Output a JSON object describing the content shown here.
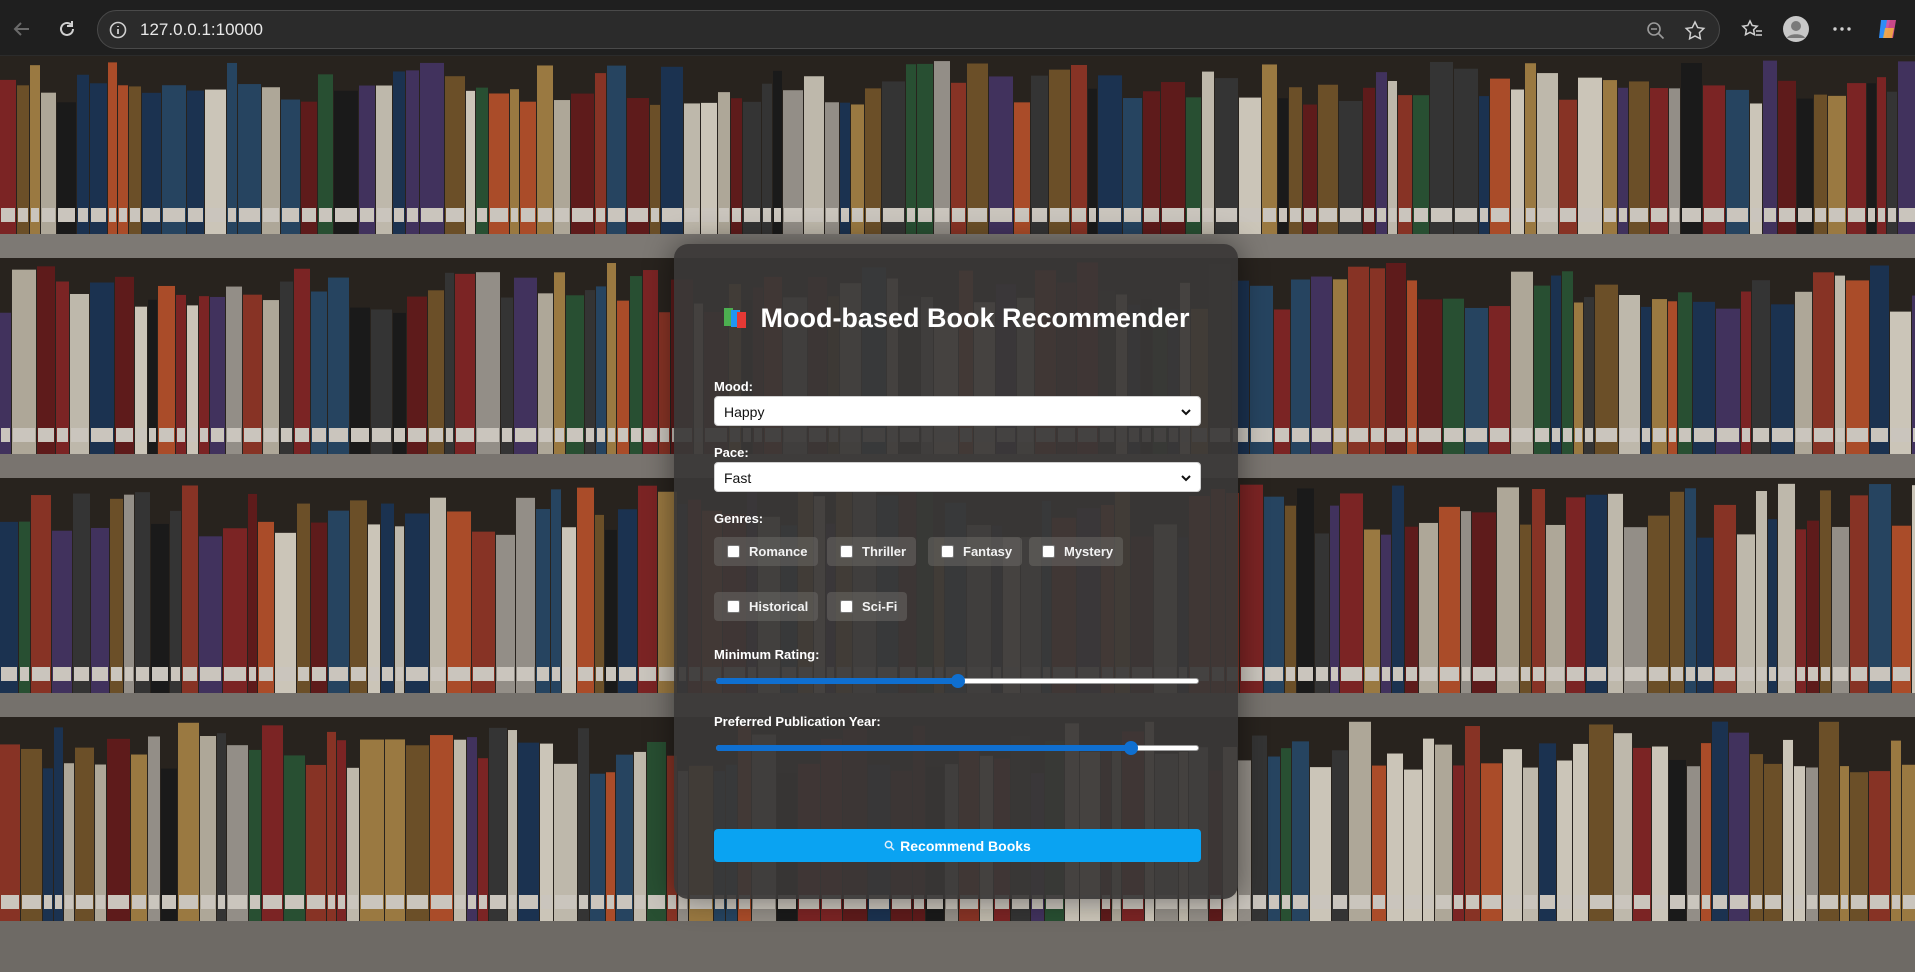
{
  "browser": {
    "url": "127.0.0.1:10000"
  },
  "page": {
    "title": "Mood-based Book Recommender",
    "mood": {
      "label": "Mood:",
      "value": "Happy"
    },
    "pace": {
      "label": "Pace:",
      "value": "Fast"
    },
    "genres": {
      "label": "Genres:",
      "items": [
        {
          "label": "Romance",
          "checked": false
        },
        {
          "label": "Thriller",
          "checked": false
        },
        {
          "label": "Fantasy",
          "checked": false
        },
        {
          "label": "Mystery",
          "checked": false
        },
        {
          "label": "Historical",
          "checked": false
        },
        {
          "label": "Sci-Fi",
          "checked": false
        }
      ]
    },
    "min_rating": {
      "label": "Minimum Rating:",
      "fraction": 0.5
    },
    "pub_year": {
      "label": "Preferred Publication Year:",
      "fraction": 0.86
    },
    "recommend_button": "Recommend Books"
  },
  "colors": {
    "accent_button": "#0aa3f2",
    "slider": "#0f6fd0"
  }
}
